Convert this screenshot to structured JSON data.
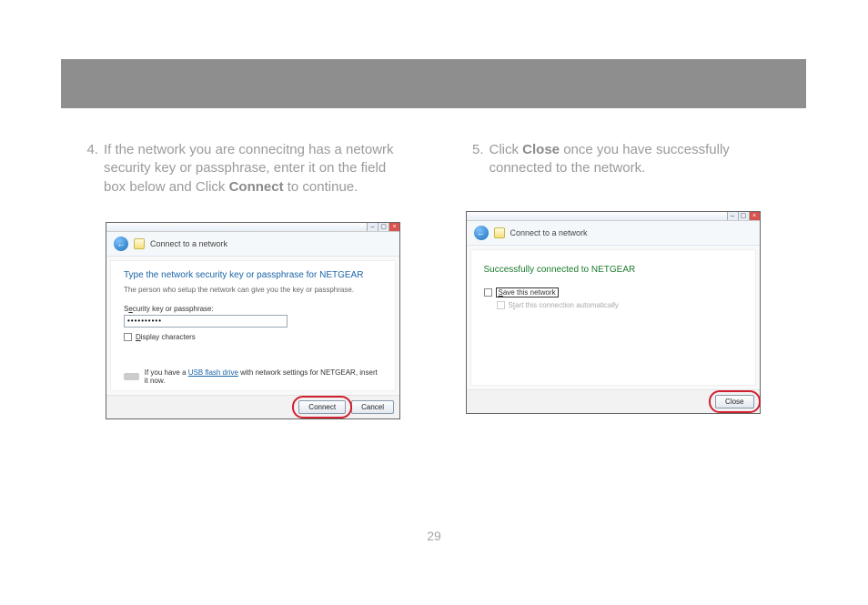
{
  "step4": {
    "num": "4.",
    "text_before_bold": "If the network you are connecitng has a netowrk security key or passphrase, enter it on the field box below and Click ",
    "bold": "Connect",
    "text_after_bold": " to continue."
  },
  "step5": {
    "num": "5.",
    "text_before_bold": "Click ",
    "bold": "Close",
    "text_after_bold": " once you have successfully connected to the network."
  },
  "dialog1": {
    "title": "Connect to a network",
    "heading": "Type the network security key or passphrase for NETGEAR",
    "subtext": "The person who setup the network can give you the key or passphrase.",
    "field_label_pre": "S",
    "field_label_under": "e",
    "field_label_post": "curity key or passphrase:",
    "input_value": "••••••••••",
    "display_chars_pre": "",
    "display_chars_under": "D",
    "display_chars_post": "isplay characters",
    "usb_pre": "If you have a ",
    "usb_link": "USB flash drive",
    "usb_post": " with network settings for NETGEAR, insert it now.",
    "connect_btn": "Connect",
    "cancel_btn": "Cancel"
  },
  "dialog2": {
    "title": "Connect to a network",
    "success": "Successfully connected to NETGEAR",
    "save_pre": "",
    "save_under": "S",
    "save_post": "ave this network",
    "auto_pre": "S",
    "auto_under": "t",
    "auto_post": "art this connection automatically",
    "close_btn": "Close"
  },
  "page_number": "29"
}
